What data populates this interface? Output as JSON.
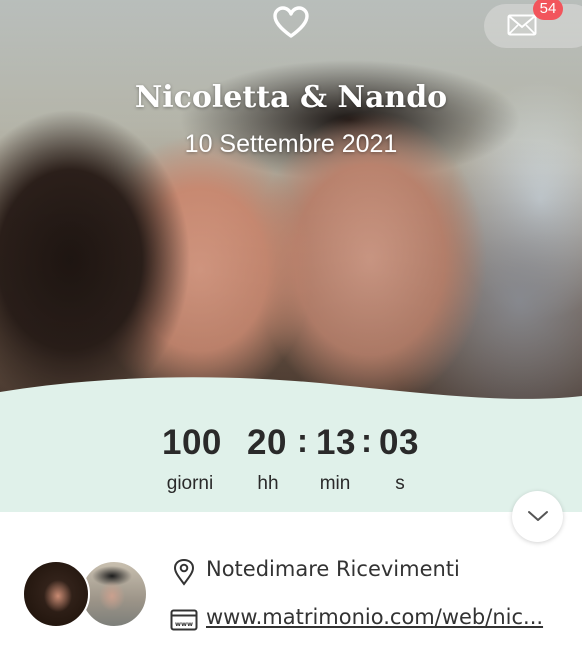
{
  "couple": {
    "names": "Nicoletta & Nando",
    "date": "10 Settembre 2021"
  },
  "inbox": {
    "badge_count": "54"
  },
  "countdown": {
    "days": "100",
    "days_label": "giorni",
    "hours": "20",
    "hours_label": "hh",
    "minutes": "13",
    "minutes_label": "min",
    "seconds": "03",
    "seconds_label": "s",
    "separator": ":"
  },
  "details": {
    "venue": "Notedimare Ricevimenti",
    "website": "www.matrimonio.com/web/nic..."
  },
  "colors": {
    "mint": "#e0f1ea",
    "badge": "#f2555c",
    "text": "#2a2a2a"
  },
  "icons": [
    "heart-icon",
    "mail-icon",
    "chevron-down-icon",
    "location-pin-icon",
    "web-browser-icon"
  ]
}
